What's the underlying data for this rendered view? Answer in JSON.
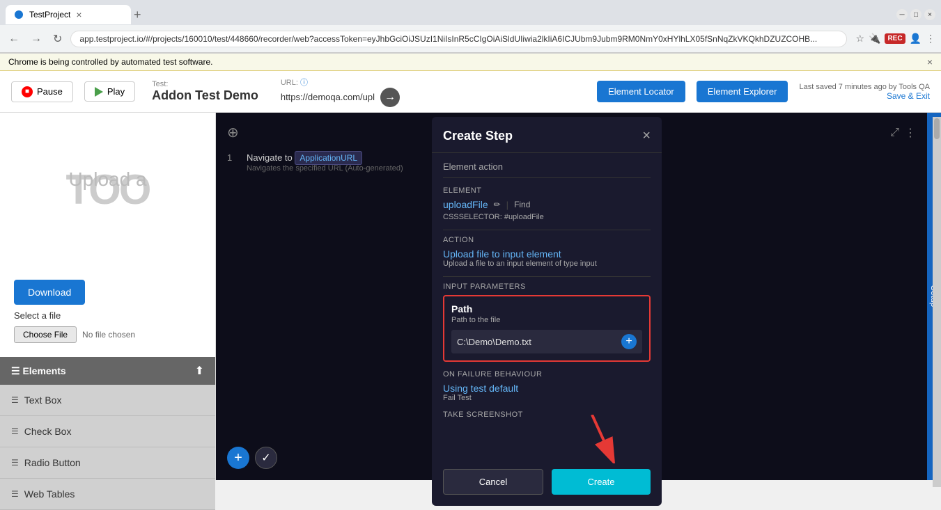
{
  "browser": {
    "tab_title": "TestProject",
    "url": "app.testproject.io/#/projects/160010/test/448660/recorder/web?accessToken=eyJhbGciOiJSUzI1NiIsInR5cCIgOiAiSldUIiwia2lkIiA6ICJUbm9Jubm9RM0NmY0xHYlhLX05fSnNqZkVKQkhDZUZCOHB...",
    "url_display": "app.testproject.io/#/projects/160010/test/448660/recorder/web?accessToken=eyJhbGci...",
    "automated_banner": "Chrome is being controlled by automated test software."
  },
  "toolbar": {
    "pause_label": "Pause",
    "play_label": "Play",
    "test_label": "Test:",
    "test_name": "Addon Test Demo",
    "url_label": "URL:",
    "url_value": "https://demoqa.com/upl",
    "element_locator_label": "Element Locator",
    "element_explorer_label": "Element Explorer",
    "save_info": "Last saved 7 minutes ago by Tools QA",
    "save_link_label": "Save & Exit"
  },
  "left_panel": {
    "upload_text": "Upload a",
    "download_btn": "Download",
    "select_file_label": "Select a file",
    "choose_file_btn": "Choose File",
    "no_file_text": "No file chosen",
    "elements_title": "Elements",
    "elements": [
      {
        "label": "Text Box",
        "icon": "☰"
      },
      {
        "label": "Check Box",
        "icon": "☰"
      },
      {
        "label": "Radio Button",
        "icon": "☰"
      },
      {
        "label": "Web Tables",
        "icon": "☰"
      }
    ]
  },
  "modal": {
    "title": "Create Step",
    "close_icon": "×",
    "element_action_label": "Element action",
    "element_section_label": "Element",
    "element_name": "uploadFile",
    "edit_icon": "✏",
    "find_label": "Find",
    "css_selector": "CSSSELECTOR: #uploadFile",
    "action_section_label": "Action",
    "action_link": "Upload file to input element",
    "action_desc": "Upload a file to an input element of type input",
    "input_params_label": "Input parameters",
    "path_title": "Path",
    "path_desc": "Path to the file",
    "path_value": "C:\\Demo\\Demo.txt",
    "failure_section_label": "On Failure Behaviour",
    "failure_link": "Using test default",
    "failure_desc": "Fail Test",
    "screenshot_label": "Take Screenshot",
    "cancel_btn": "Cancel",
    "create_btn": "Create"
  },
  "right_panel": {
    "step_number": "1",
    "step_nav_label": "Navigate to",
    "step_url_badge": "ApplicationURL",
    "step_desc": "Navigates the specified URL (Auto-generated)"
  },
  "setup_sidebar": {
    "label": "Setup"
  }
}
